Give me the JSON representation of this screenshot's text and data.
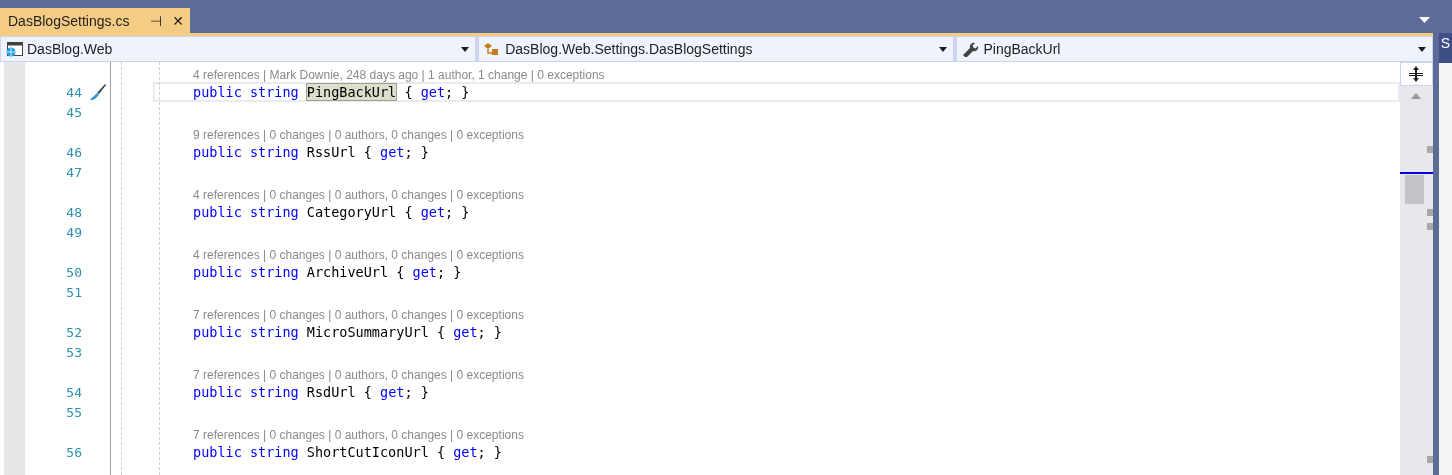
{
  "tab": {
    "title": "DasBlogSettings.cs",
    "pin": "⊣",
    "close": "✕",
    "selected": true
  },
  "nav": [
    {
      "kind": "project",
      "label": "DasBlog.Web"
    },
    {
      "kind": "class",
      "label": "DasBlog.Web.Settings.DasBlogSettings"
    },
    {
      "kind": "member",
      "label": "PingBackUrl"
    }
  ],
  "lines": [
    {
      "kind": "lens",
      "text": "4 references | Mark Downie, 248 days ago | 1 author, 1 change | 0 exceptions"
    },
    {
      "kind": "code",
      "number": "44",
      "current": true,
      "tokens": [
        {
          "kind": "keyword",
          "text": "public"
        },
        {
          "kind": "keyword",
          "text": "string"
        },
        {
          "kind": "ident",
          "text": "PingBackUrl",
          "highlighted": true
        },
        {
          "kind": "punct",
          "text": "{"
        },
        {
          "kind": "keyword",
          "text": "get"
        },
        {
          "kind": "punct",
          "text": "; }"
        }
      ]
    },
    {
      "kind": "code",
      "number": "45",
      "current": false
    },
    {
      "kind": "lens",
      "text": "9 references | 0 changes | 0 authors, 0 changes | 0 exceptions"
    },
    {
      "kind": "code",
      "number": "46",
      "current": false,
      "tokens": [
        {
          "kind": "keyword",
          "text": "public"
        },
        {
          "kind": "keyword",
          "text": "string"
        },
        {
          "kind": "ident",
          "text": "RssUrl",
          "highlighted": false
        },
        {
          "kind": "punct",
          "text": "{"
        },
        {
          "kind": "keyword",
          "text": "get"
        },
        {
          "kind": "punct",
          "text": "; }"
        }
      ]
    },
    {
      "kind": "code",
      "number": "47",
      "current": false
    },
    {
      "kind": "lens",
      "text": "4 references | 0 changes | 0 authors, 0 changes | 0 exceptions"
    },
    {
      "kind": "code",
      "number": "48",
      "current": false,
      "tokens": [
        {
          "kind": "keyword",
          "text": "public"
        },
        {
          "kind": "keyword",
          "text": "string"
        },
        {
          "kind": "ident",
          "text": "CategoryUrl",
          "highlighted": false
        },
        {
          "kind": "punct",
          "text": "{"
        },
        {
          "kind": "keyword",
          "text": "get"
        },
        {
          "kind": "punct",
          "text": "; }"
        }
      ]
    },
    {
      "kind": "code",
      "number": "49",
      "current": false
    },
    {
      "kind": "lens",
      "text": "4 references | 0 changes | 0 authors, 0 changes | 0 exceptions"
    },
    {
      "kind": "code",
      "number": "50",
      "current": false,
      "tokens": [
        {
          "kind": "keyword",
          "text": "public"
        },
        {
          "kind": "keyword",
          "text": "string"
        },
        {
          "kind": "ident",
          "text": "ArchiveUrl",
          "highlighted": false
        },
        {
          "kind": "punct",
          "text": "{"
        },
        {
          "kind": "keyword",
          "text": "get"
        },
        {
          "kind": "punct",
          "text": "; }"
        }
      ]
    },
    {
      "kind": "code",
      "number": "51",
      "current": false
    },
    {
      "kind": "lens",
      "text": "7 references | 0 changes | 0 authors, 0 changes | 0 exceptions"
    },
    {
      "kind": "code",
      "number": "52",
      "current": false,
      "tokens": [
        {
          "kind": "keyword",
          "text": "public"
        },
        {
          "kind": "keyword",
          "text": "string"
        },
        {
          "kind": "ident",
          "text": "MicroSummaryUrl",
          "highlighted": false
        },
        {
          "kind": "punct",
          "text": "{"
        },
        {
          "kind": "keyword",
          "text": "get"
        },
        {
          "kind": "punct",
          "text": "; }"
        }
      ]
    },
    {
      "kind": "code",
      "number": "53",
      "current": false
    },
    {
      "kind": "lens",
      "text": "7 references | 0 changes | 0 authors, 0 changes | 0 exceptions"
    },
    {
      "kind": "code",
      "number": "54",
      "current": false,
      "tokens": [
        {
          "kind": "keyword",
          "text": "public"
        },
        {
          "kind": "keyword",
          "text": "string"
        },
        {
          "kind": "ident",
          "text": "RsdUrl",
          "highlighted": false
        },
        {
          "kind": "punct",
          "text": "{"
        },
        {
          "kind": "keyword",
          "text": "get"
        },
        {
          "kind": "punct",
          "text": "; }"
        }
      ]
    },
    {
      "kind": "code",
      "number": "55",
      "current": false
    },
    {
      "kind": "lens",
      "text": "7 references | 0 changes | 0 authors, 0 changes | 0 exceptions"
    },
    {
      "kind": "code",
      "number": "56",
      "current": false,
      "tokens": [
        {
          "kind": "keyword",
          "text": "public"
        },
        {
          "kind": "keyword",
          "text": "string"
        },
        {
          "kind": "ident",
          "text": "ShortCutIconUrl",
          "highlighted": false
        },
        {
          "kind": "punct",
          "text": "{"
        },
        {
          "kind": "keyword",
          "text": "get"
        },
        {
          "kind": "punct",
          "text": "; }"
        }
      ]
    }
  ],
  "side_panel": {
    "title": "S"
  }
}
